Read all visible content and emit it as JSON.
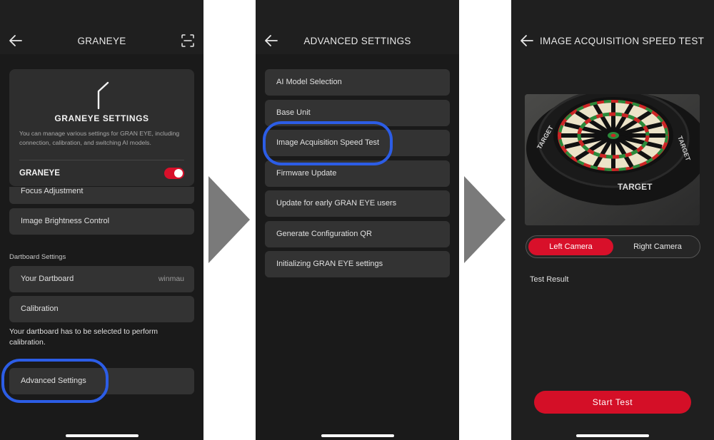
{
  "screen1": {
    "title": "GRANEYE",
    "card": {
      "title": "GRANEYE SETTINGS",
      "description": "You can manage various settings for GRAN EYE, including connection, calibration, and switching AI models.",
      "toggle_label": "GRANEYE",
      "toggle_on": true
    },
    "partial_row": "Focus Adjustment",
    "brightness_row": "Image Brightness Control",
    "section_title": "Dartboard Settings",
    "dartboard_row": {
      "label": "Your Dartboard",
      "value": "winmau"
    },
    "calibration_row": "Calibration",
    "calibration_note": "Your dartboard has to be selected to perform calibration.",
    "advanced_row": "Advanced Settings"
  },
  "screen2": {
    "title": "ADVANCED SETTINGS",
    "items": [
      "AI Model Selection",
      "Base Unit",
      "Image Acquisition Speed Test",
      "Firmware Update",
      "Update for early GRAN EYE users",
      "Generate Configuration QR",
      "Initializing GRAN EYE settings"
    ]
  },
  "screen3": {
    "title": "IMAGE ACQUISITION SPEED TEST",
    "camera_options": [
      "Left Camera",
      "Right Camera"
    ],
    "selected_camera": "Left Camera",
    "board_text": [
      "TARGET",
      "TARGET",
      "TARGET"
    ],
    "test_result_label": "Test Result",
    "start_button": "Start Test"
  },
  "colors": {
    "accent_red": "#d8102a",
    "highlight_blue": "#2c5de6",
    "flow_arrow_gray": "#7a7a7a",
    "background_dark": "#1f1f1f",
    "row_background": "#333333"
  },
  "icons": {
    "back": "arrow-left-icon",
    "scan": "scan-frame-icon",
    "sensor": "graneye-sensor-icon",
    "flow_arrow": "triangle-right-icon"
  }
}
